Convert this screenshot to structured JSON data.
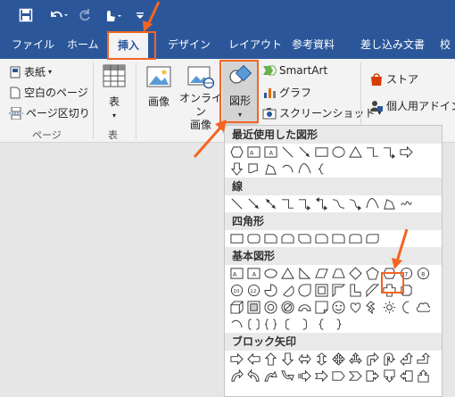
{
  "tabs": [
    "ファイル",
    "ホーム",
    "挿入",
    "デザイン",
    "レイアウト",
    "参考資料",
    "差し込み文書",
    "校"
  ],
  "active_tab": "挿入",
  "ribbon": {
    "pages": {
      "cover": "表紙",
      "blank": "空白のページ",
      "break": "ページ区切り",
      "group": "ページ"
    },
    "table": {
      "label": "表",
      "group": "表"
    },
    "illustrations": {
      "picture": "画像",
      "online_line1": "オンライン",
      "online_line2": "画像",
      "shapes": "図形",
      "smartart": "SmartArt",
      "chart": "グラフ",
      "screenshot": "スクリーンショット"
    },
    "addins": {
      "store": "ストア",
      "personal": "個人用アドイン"
    }
  },
  "gallery": {
    "sections": [
      "最近使用した図形",
      "線",
      "四角形",
      "基本図形",
      "ブロック矢印"
    ]
  },
  "colors": {
    "accent": "#2b579a",
    "highlight": "#f26522",
    "office_red": "#d83b01"
  }
}
